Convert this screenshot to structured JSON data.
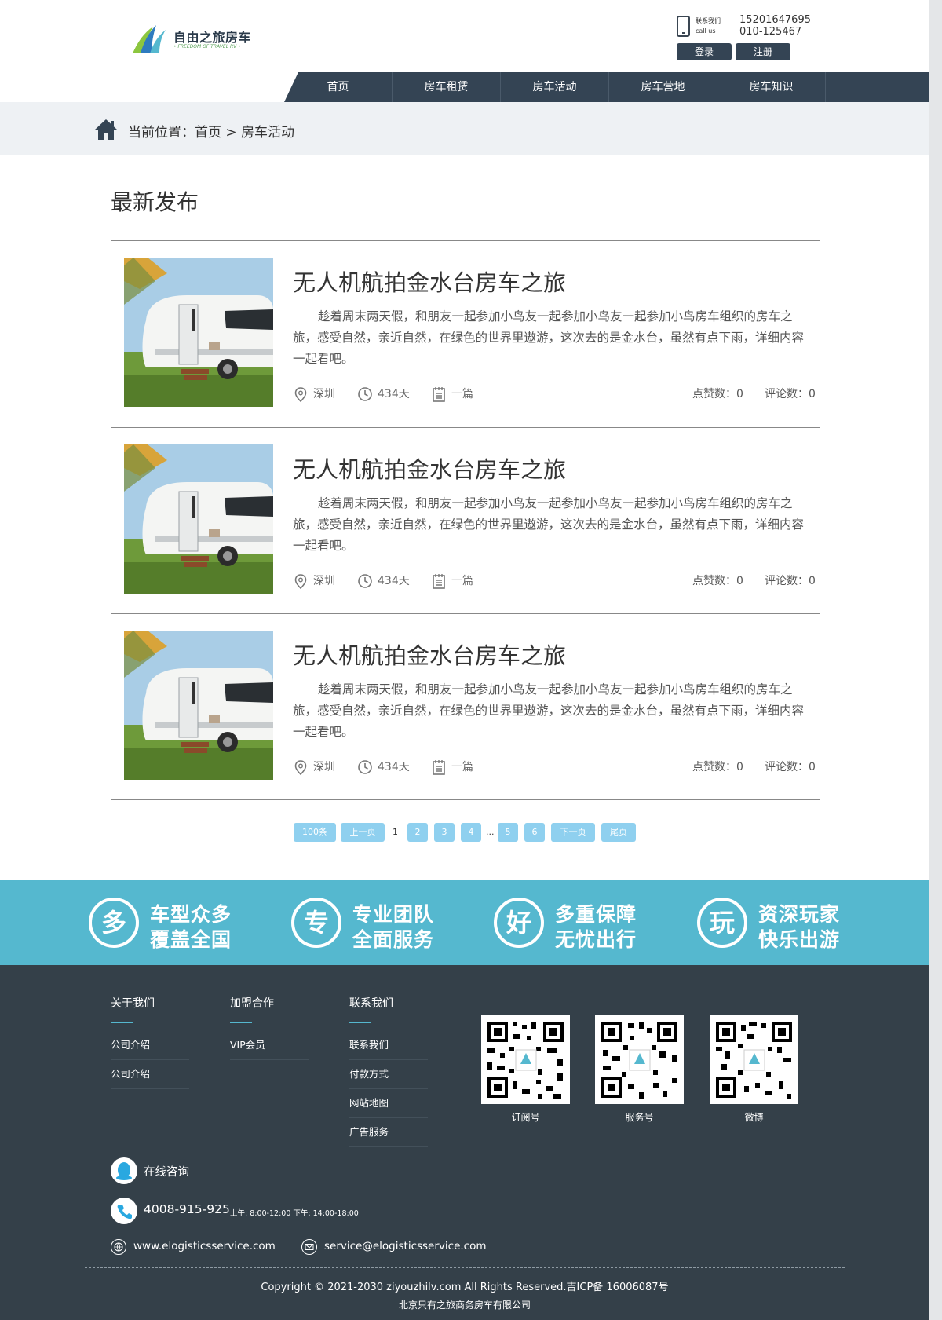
{
  "colors": {
    "nav_bg": "#344454",
    "accent": "#55b8cf",
    "footer_bg": "#344049",
    "pager": "#8fd0ef"
  },
  "header": {
    "logo_text": "自由之旅房车",
    "logo_sub": "• FREEDOM OF TRAVEL RV •",
    "contact_label1": "联系我们",
    "contact_label2": "call us",
    "phone1": "15201647695",
    "phone2": "010-125467",
    "login": "登录",
    "register": "注册",
    "nav": [
      "首页",
      "房车租赁",
      "房车活动",
      "房车营地",
      "房车知识"
    ]
  },
  "breadcrumb": {
    "text": "当前位置：首页 > 房车活动"
  },
  "section_title": "最新发布",
  "posts": [
    {
      "title": "无人机航拍金水台房车之旅",
      "desc": "趁着周末两天假，和朋友一起参加小鸟友一起参加小鸟友一起参加小鸟房车组织的房车之旅，感受自然，亲近自然，在绿色的世界里遨游，这次去的是金水台，虽然有点下雨，详细内容一起看吧。",
      "location": "深圳",
      "days": "434天",
      "count": "一篇",
      "likes": "点赞数：0",
      "comments": "评论数：0"
    },
    {
      "title": "无人机航拍金水台房车之旅",
      "desc": "趁着周末两天假，和朋友一起参加小鸟友一起参加小鸟友一起参加小鸟房车组织的房车之旅，感受自然，亲近自然，在绿色的世界里遨游，这次去的是金水台，虽然有点下雨，详细内容一起看吧。",
      "location": "深圳",
      "days": "434天",
      "count": "一篇",
      "likes": "点赞数：0",
      "comments": "评论数：0"
    },
    {
      "title": "无人机航拍金水台房车之旅",
      "desc": "趁着周末两天假，和朋友一起参加小鸟友一起参加小鸟友一起参加小鸟房车组织的房车之旅，感受自然，亲近自然，在绿色的世界里遨游，这次去的是金水台，虽然有点下雨，详细内容一起看吧。",
      "location": "深圳",
      "days": "434天",
      "count": "一篇",
      "likes": "点赞数：0",
      "comments": "评论数：0"
    }
  ],
  "pager": {
    "total": "100条",
    "prev": "上一页",
    "current": "1",
    "pages": [
      "2",
      "3",
      "4",
      "5",
      "6"
    ],
    "ellipsis": "...",
    "next": "下一页",
    "last": "尾页"
  },
  "features": [
    {
      "char": "多",
      "line1": "车型众多",
      "line2": "覆盖全国"
    },
    {
      "char": "专",
      "line1": "专业团队",
      "line2": "全面服务"
    },
    {
      "char": "好",
      "line1": "多重保障",
      "line2": "无忧出行"
    },
    {
      "char": "玩",
      "line1": "资深玩家",
      "line2": "快乐出游"
    }
  ],
  "footer": {
    "columns": [
      {
        "title": "关于我们",
        "links": [
          "公司介绍",
          "公司介绍"
        ]
      },
      {
        "title": "加盟合作",
        "links": [
          "VIP会员"
        ]
      },
      {
        "title": "联系我们",
        "links": [
          "联系我们",
          "付款方式",
          "网站地图",
          "广告服务"
        ]
      }
    ],
    "qrs": [
      "订阅号",
      "服务号",
      "微博"
    ],
    "online": "在线咨询",
    "tel": "4008-915-925",
    "hours": "上午: 8:00-12:00   下午: 14:00-18:00",
    "website": "www.elogisticsservice.com",
    "email": "service@elogisticsservice.com",
    "copyright": "Copyright © 2021-2030 ziyouzhilv.com All Rights Reserved.吉ICP备 16006087号",
    "company": "北京只有之旅商务房车有限公司"
  }
}
